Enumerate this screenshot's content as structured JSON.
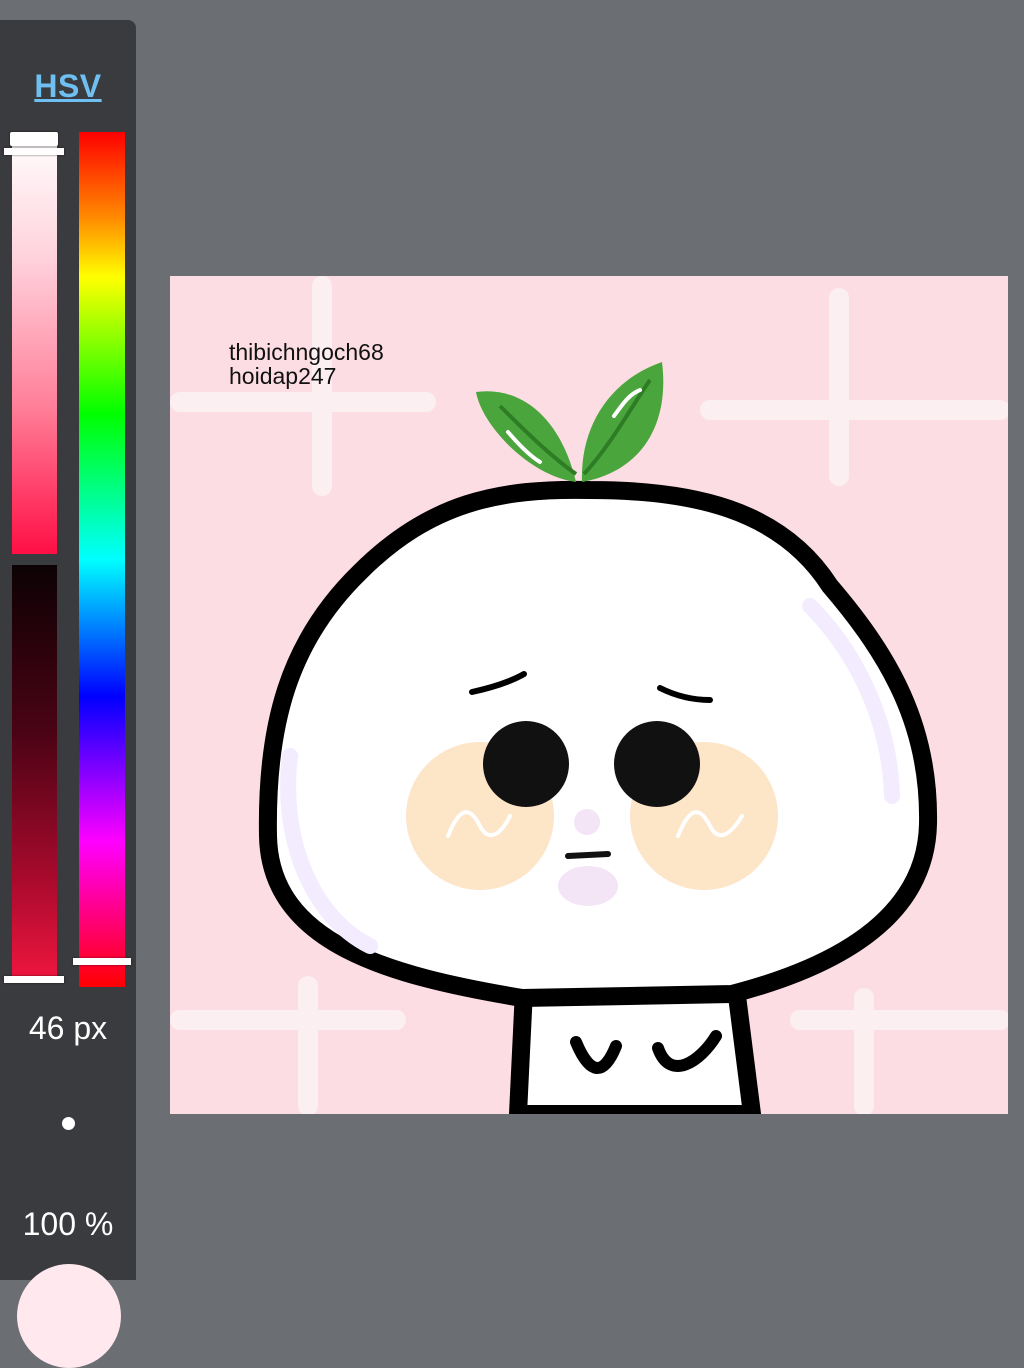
{
  "sidebar": {
    "mode_tab": "HSV",
    "brush_size": "46 px",
    "opacity": "100 %"
  },
  "canvas": {
    "watermark_line1": "thibichngoch68",
    "watermark_line2": "hoidap247",
    "background_color": "#fddde4"
  },
  "colors": {
    "sidebar": "#3a3b3e",
    "workspace": "#6b6e73",
    "accent": "#6fc0f2",
    "selected_color": "#ffe8ee"
  }
}
